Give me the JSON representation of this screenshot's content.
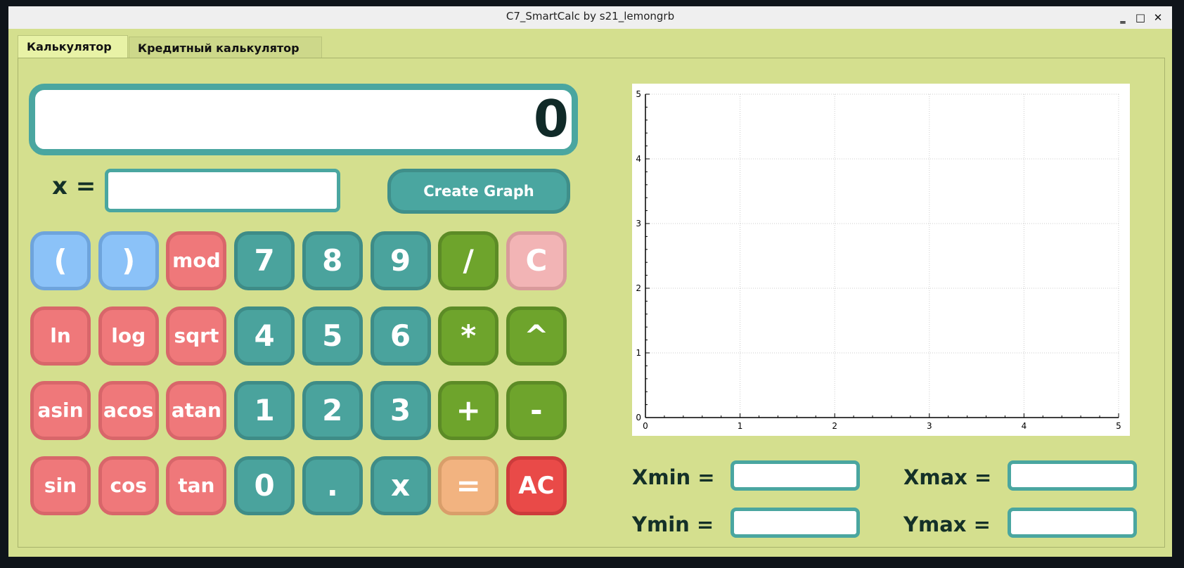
{
  "window": {
    "title": "C7_SmartCalc by s21_lemongrb",
    "minimize": "‗",
    "maximize": "□",
    "close": "✕"
  },
  "tabs": [
    {
      "label": "Калькулятор",
      "active": true
    },
    {
      "label": "Кредитный калькулятор",
      "active": false
    }
  ],
  "calculator": {
    "display": "0",
    "x_label": "x =",
    "x_value": "",
    "create_graph": "Create Graph",
    "keys": [
      [
        {
          "l": "(",
          "c": "blue",
          "n": "open-paren"
        },
        {
          "l": ")",
          "c": "blue",
          "n": "close-paren"
        },
        {
          "l": "mod",
          "c": "pink",
          "n": "mod"
        },
        {
          "l": "7",
          "c": "teal",
          "n": "7"
        },
        {
          "l": "8",
          "c": "teal",
          "n": "8"
        },
        {
          "l": "9",
          "c": "teal",
          "n": "9"
        },
        {
          "l": "/",
          "c": "green",
          "n": "divide"
        },
        {
          "l": "C",
          "c": "lpink",
          "n": "clear"
        }
      ],
      [
        {
          "l": "ln",
          "c": "pink",
          "n": "ln"
        },
        {
          "l": "log",
          "c": "pink",
          "n": "log"
        },
        {
          "l": "sqrt",
          "c": "pink",
          "n": "sqrt"
        },
        {
          "l": "4",
          "c": "teal",
          "n": "4"
        },
        {
          "l": "5",
          "c": "teal",
          "n": "5"
        },
        {
          "l": "6",
          "c": "teal",
          "n": "6"
        },
        {
          "l": "*",
          "c": "green",
          "n": "multiply"
        },
        {
          "l": "^",
          "c": "green",
          "n": "power"
        }
      ],
      [
        {
          "l": "asin",
          "c": "pink",
          "n": "asin"
        },
        {
          "l": "acos",
          "c": "pink",
          "n": "acos"
        },
        {
          "l": "atan",
          "c": "pink",
          "n": "atan"
        },
        {
          "l": "1",
          "c": "teal",
          "n": "1"
        },
        {
          "l": "2",
          "c": "teal",
          "n": "2"
        },
        {
          "l": "3",
          "c": "teal",
          "n": "3"
        },
        {
          "l": "+",
          "c": "green",
          "n": "plus"
        },
        {
          "l": "-",
          "c": "green",
          "n": "minus"
        }
      ],
      [
        {
          "l": "sin",
          "c": "pink",
          "n": "sin"
        },
        {
          "l": "cos",
          "c": "pink",
          "n": "cos"
        },
        {
          "l": "tan",
          "c": "pink",
          "n": "tan"
        },
        {
          "l": "0",
          "c": "teal",
          "n": "0"
        },
        {
          "l": ".",
          "c": "teal",
          "n": "dot"
        },
        {
          "l": "x",
          "c": "teal",
          "n": "x"
        },
        {
          "l": "=",
          "c": "orange",
          "n": "equals"
        },
        {
          "l": "AC",
          "c": "red",
          "n": "all-clear"
        }
      ]
    ]
  },
  "ranges": {
    "xmin_label": "Xmin =",
    "xmax_label": "Xmax =",
    "ymin_label": "Ymin =",
    "ymax_label": "Ymax =",
    "xmin": "",
    "xmax": "",
    "ymin": "",
    "ymax": ""
  },
  "chart_data": {
    "type": "line",
    "title": "",
    "xlabel": "",
    "ylabel": "",
    "xlim": [
      0,
      5
    ],
    "ylim": [
      0,
      5
    ],
    "xticks": [
      "0",
      "1",
      "2",
      "3",
      "4",
      "5"
    ],
    "yticks": [
      "0",
      "1",
      "2",
      "3",
      "4",
      "5"
    ],
    "grid": true,
    "series": []
  }
}
